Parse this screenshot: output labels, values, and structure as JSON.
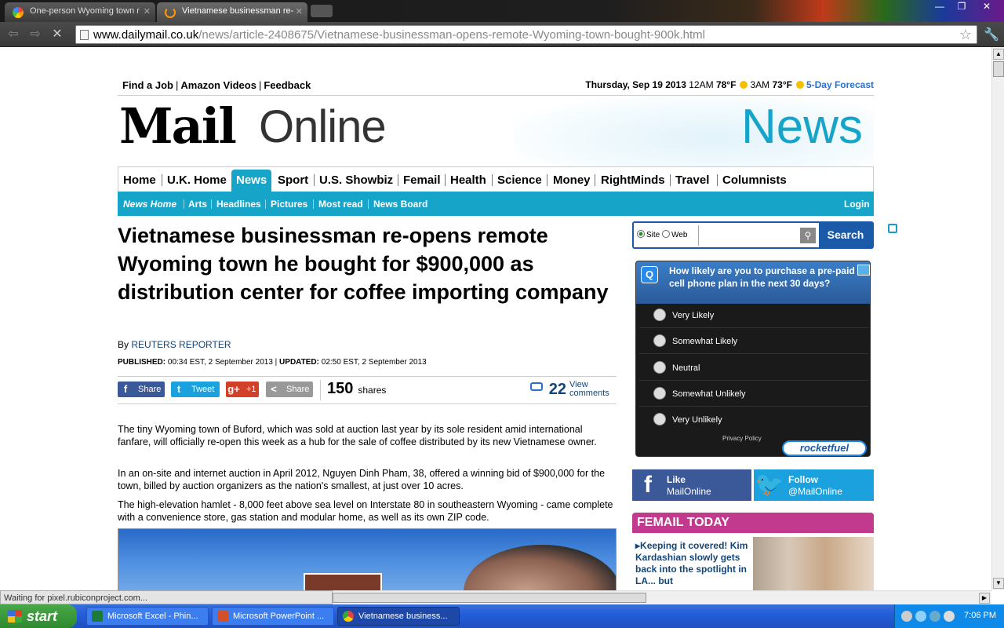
{
  "browser": {
    "tabs": [
      {
        "label": "One-person Wyoming town r",
        "active": false
      },
      {
        "label": "Vietnamese businessman re-",
        "active": true
      }
    ],
    "url_host": "www.dailymail.co.uk",
    "url_path": "/news/article-2408675/Vietnamese-businessman-opens-remote-Wyoming-town-bought-900k.html",
    "status": "Waiting for pixel.rubiconproject.com..."
  },
  "top_links": [
    "Find a Job",
    "Amazon Videos",
    "Feedback"
  ],
  "weather": {
    "date": "Thursday, Sep 19 2013",
    "t1_time": "12AM",
    "t1_temp": "78°F",
    "t2_time": "3AM",
    "t2_temp": "73°F",
    "forecast": "5-Day Forecast"
  },
  "masthead": {
    "mail": "Mail",
    "online": "Online",
    "section": "News"
  },
  "nav": [
    "Home",
    "U.K. Home",
    "News",
    "Sport",
    "U.S. Showbiz",
    "Femail",
    "Health",
    "Science",
    "Money",
    "RightMinds",
    "Travel",
    "Columnists"
  ],
  "subnav": [
    "News Home",
    "Arts",
    "Headlines",
    "Pictures",
    "Most read",
    "News Board"
  ],
  "login": "Login",
  "article": {
    "headline": "Vietnamese businessman re-opens remote Wyoming town he bought for $900,000 as distribution center for coffee importing company",
    "by": "By",
    "author": "REUTERS REPORTER",
    "published_label": "PUBLISHED:",
    "published": "00:34 EST, 2 September 2013",
    "updated_label": "UPDATED:",
    "updated": "02:50 EST, 2 September 2013",
    "paragraphs": [
      "The tiny Wyoming town of Buford, which was sold at auction last year by its sole resident amid international fanfare, will officially re-open this week as a hub for the sale of coffee distributed by its new Vietnamese owner.",
      "In an on-site and internet auction in April 2012, Nguyen Dinh Pham, 38, offered a winning bid of $900,000 for the town, billed by auction organizers as the nation's smallest, at just over 10 acres.",
      "The high-elevation hamlet - 8,000 feet above sea level on Interstate 80 in southeastern Wyoming - came complete with a convenience store, gas station and modular home, as well as its own ZIP code."
    ]
  },
  "share": {
    "facebook": "Share",
    "twitter": "Tweet",
    "gplus": "+1",
    "other": "Share",
    "count": "150",
    "count_label": "shares",
    "comments": "22",
    "comments_label": "View comments"
  },
  "search": {
    "site": "Site",
    "web": "Web",
    "button": "Search"
  },
  "poll": {
    "question": "How likely are you to purchase a pre-paid cell phone plan in the next 30 days?",
    "options": [
      "Very Likely",
      "Somewhat Likely",
      "Neutral",
      "Somewhat Unlikely",
      "Very Unlikely"
    ],
    "privacy": "Privacy Policy",
    "brand": "rocketfuel"
  },
  "social": {
    "fb_action": "Like",
    "fb_account": "MailOnline",
    "tw_action": "Follow",
    "tw_account": "@MailOnline"
  },
  "femail": {
    "title": "FEMAIL TODAY",
    "story": "Keeping it covered! Kim Kardashian slowly gets back into the spotlight in LA... but"
  },
  "taskbar": {
    "start": "start",
    "tasks": [
      "Microsoft Excel - Phin...",
      "Microsoft PowerPoint ...",
      "Vietnamese business..."
    ],
    "clock": "7:06 PM"
  }
}
